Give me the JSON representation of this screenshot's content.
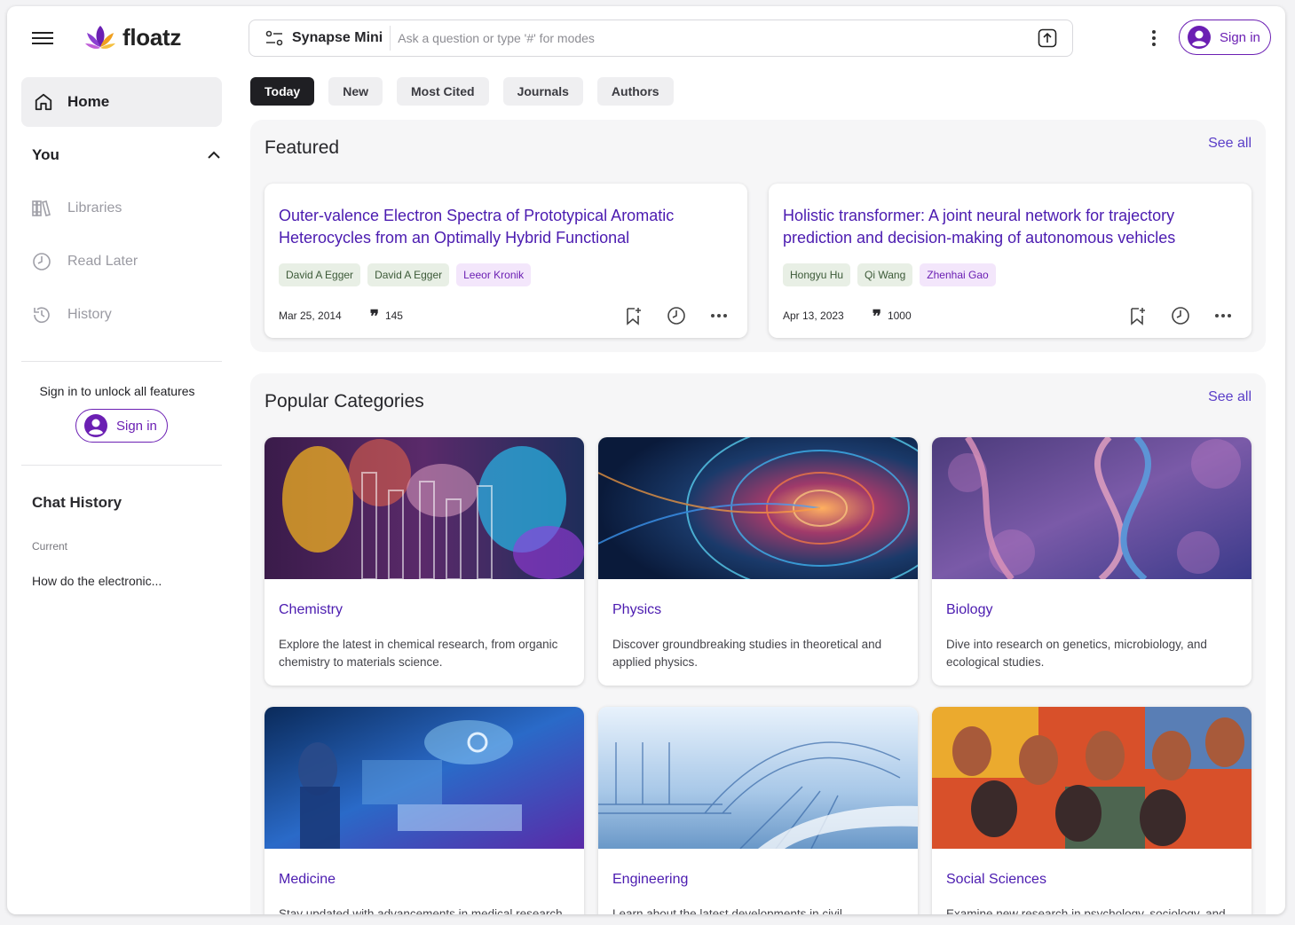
{
  "brand": {
    "name": "floatz"
  },
  "sidebar": {
    "home_label": "Home",
    "you_label": "You",
    "items": [
      {
        "label": "Libraries",
        "icon": "library-icon"
      },
      {
        "label": "Read Later",
        "icon": "clock-icon"
      },
      {
        "label": "History",
        "icon": "history-icon"
      }
    ],
    "signin_message": "Sign in to unlock all features",
    "signin_label": "Sign in",
    "chat_history_title": "Chat History",
    "chat_section": "Current",
    "chat_items": [
      "How do the electronic..."
    ]
  },
  "search": {
    "mode_label": "Synapse Mini",
    "placeholder": "Ask a question or type '#' for modes"
  },
  "header": {
    "signin_label": "Sign in"
  },
  "tabs": [
    {
      "label": "Today",
      "active": true
    },
    {
      "label": "New",
      "active": false
    },
    {
      "label": "Most Cited",
      "active": false
    },
    {
      "label": "Journals",
      "active": false
    },
    {
      "label": "Authors",
      "active": false
    }
  ],
  "featured": {
    "title": "Featured",
    "see_all": "See all",
    "papers": [
      {
        "title": "Outer-valence Electron Spectra of Prototypical Aromatic Heterocycles from an Optimally Hybrid Functional",
        "authors": [
          {
            "name": "David A Egger",
            "style": "green"
          },
          {
            "name": "David A Egger",
            "style": "green"
          },
          {
            "name": "Leeor Kronik",
            "style": "purple"
          }
        ],
        "date": "Mar 25, 2014",
        "citations": "145"
      },
      {
        "title": "Holistic transformer: A joint neural network for trajectory prediction and decision-making of autonomous vehicles",
        "authors": [
          {
            "name": "Hongyu Hu",
            "style": "green"
          },
          {
            "name": "Qi Wang",
            "style": "green"
          },
          {
            "name": "Zhenhai Gao",
            "style": "purple"
          }
        ],
        "date": "Apr 13, 2023",
        "citations": "1000"
      }
    ]
  },
  "popular": {
    "title": "Popular Categories",
    "see_all": "See all",
    "categories": [
      {
        "name": "Chemistry",
        "description": "Explore the latest in chemical research, from organic chemistry to materials science."
      },
      {
        "name": "Physics",
        "description": "Discover groundbreaking studies in theoretical and applied physics."
      },
      {
        "name": "Biology",
        "description": "Dive into research on genetics, microbiology, and ecological studies."
      },
      {
        "name": "Medicine",
        "description": "Stay updated with advancements in medical research and healthcare."
      },
      {
        "name": "Engineering",
        "description": "Learn about the latest developments in civil, mechanical and electrical engineering."
      },
      {
        "name": "Social Sciences",
        "description": "Examine new research in psychology, sociology, and economics."
      }
    ]
  },
  "colors": {
    "accent": "#4b1bb0",
    "brand_purple": "#6b1fb3",
    "link": "#5a3ec8",
    "chip_green": "#e8efe5",
    "chip_purple": "#f3e6fb"
  }
}
